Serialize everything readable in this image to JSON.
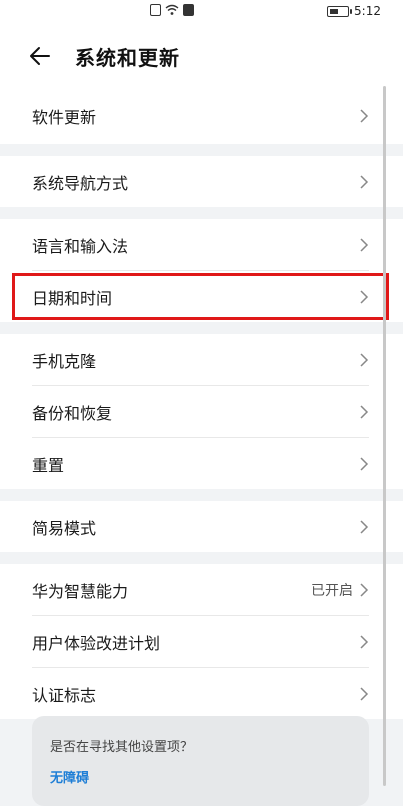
{
  "status_bar": {
    "time": "5:12"
  },
  "header": {
    "title": "系统和更新"
  },
  "groups": [
    {
      "items": [
        {
          "label": "软件更新"
        }
      ]
    },
    {
      "items": [
        {
          "label": "系统导航方式"
        }
      ]
    },
    {
      "items": [
        {
          "label": "语言和输入法"
        },
        {
          "label": "日期和时间"
        }
      ]
    },
    {
      "items": [
        {
          "label": "手机克隆"
        },
        {
          "label": "备份和恢复"
        },
        {
          "label": "重置"
        }
      ]
    },
    {
      "items": [
        {
          "label": "简易模式"
        }
      ]
    },
    {
      "items": [
        {
          "label": "华为智慧能力",
          "status": "已开启"
        },
        {
          "label": "用户体验改进计划"
        },
        {
          "label": "认证标志"
        }
      ]
    }
  ],
  "suggestion": {
    "question": "是否在寻找其他设置项？",
    "link": "无障碍"
  },
  "colors": {
    "highlight": "#e01818",
    "link": "#1e7ed6",
    "background": "#f1f3f5"
  }
}
